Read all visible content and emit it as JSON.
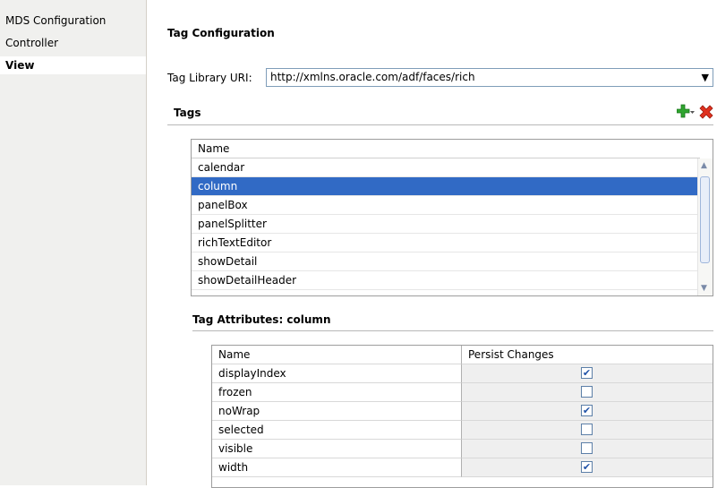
{
  "nav": {
    "items": [
      {
        "label": "MDS Configuration",
        "active": false
      },
      {
        "label": "Controller",
        "active": false
      },
      {
        "label": "View",
        "active": true
      }
    ]
  },
  "header": {
    "title": "Tag Configuration"
  },
  "uri": {
    "label": "Tag Library URI:",
    "value": "http://xmlns.oracle.com/adf/faces/rich"
  },
  "tags": {
    "section_title": "Tags",
    "column_header": "Name",
    "rows": [
      "calendar",
      "column",
      "panelBox",
      "panelSplitter",
      "richTextEditor",
      "showDetail",
      "showDetailHeader"
    ],
    "selected_index": 1
  },
  "attributes": {
    "section_title": "Tag Attributes: column",
    "headers": [
      "Name",
      "Persist Changes"
    ],
    "rows": [
      {
        "name": "displayIndex",
        "persist": true
      },
      {
        "name": "frozen",
        "persist": false
      },
      {
        "name": "noWrap",
        "persist": true
      },
      {
        "name": "selected",
        "persist": false
      },
      {
        "name": "visible",
        "persist": false
      },
      {
        "name": "width",
        "persist": true
      }
    ]
  },
  "icons": {
    "add": "add-plus-icon",
    "add_menu": "chevron-down-icon",
    "delete": "delete-x-icon"
  }
}
